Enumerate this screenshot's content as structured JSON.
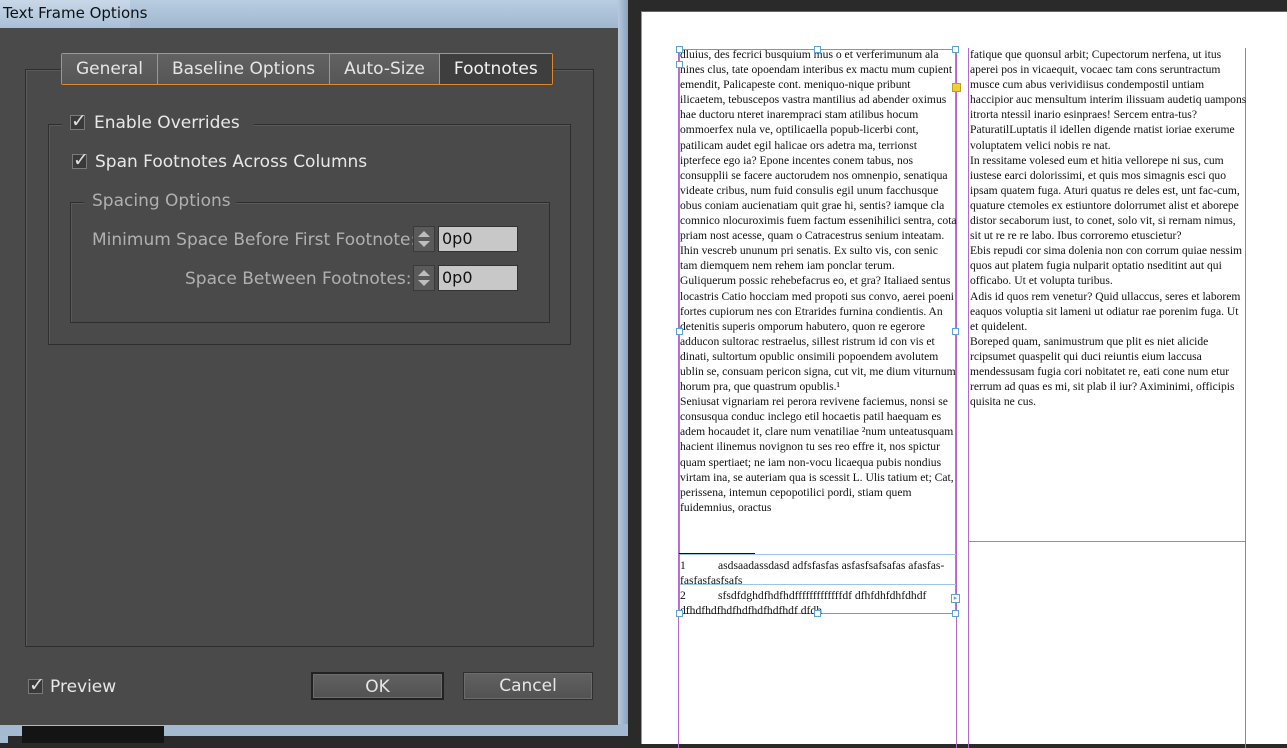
{
  "window": {
    "title": "Text Frame Options"
  },
  "tabs": [
    {
      "label": "General"
    },
    {
      "label": "Baseline Options"
    },
    {
      "label": "Auto-Size"
    },
    {
      "label": "Footnotes",
      "active": true
    }
  ],
  "footnotes": {
    "enable_overrides_label": "Enable Overrides",
    "enable_overrides_checked": true,
    "span_label": "Span Footnotes Across Columns",
    "span_checked": true,
    "spacing_group_label": "Spacing Options",
    "min_space_label": "Minimum Space Before First Footnote:",
    "min_space_value": "0p0",
    "between_label": "Space Between Footnotes:",
    "between_value": "0p0"
  },
  "footer": {
    "preview_label": "Preview",
    "preview_checked": true,
    "ok_label": "OK",
    "cancel_label": "Cancel"
  },
  "document": {
    "column1": [
      "dluius, des fecrici busquium mus o et verferimunum ala nines clus, tate opoendam interibus ex mactu mum cupient emendit, Palicapeste cont. meniquo-nique pribunt ilicaetem, tebuscepos vastra mantilius ad abender oximus hae ductoru nteret inarempraci stam atilibus hocum ommoerfex nula ve, optilicaella popub-licerbi cont, patilicam audet egil halicae ors adetra ma, terrionst ipterfece ego ia? Epone incentes conem tabus, nos consupplii se facere auctorudem nos omnenpio, senatiqua videate cribus, num fuid consulis egil unum facchusque obus coniam aucienatiam quit grae hi, sentis? iamque cla comnico nlocuroximis fuem factum essenihilici sentra, cota priam nost acesse, quam o Catracestrus senium inteatam. Ihin vescreb ununum pri senatis. Ex sulto vis, con senic tam diemquem nem rehem iam ponclar terum.",
      "Guliquerum possic rehebefacrus eo, et gra? Italiaed sentus locastris Catio hocciam med propoti sus convo, aerei poeni fortes cupiorum nes con Etrarides furnina condientis. An detenitis superis omporum habutero, quon re egerore adducon sultorac restraelus, sillest ristrum id con vis et dinati, sultortum opublic onsimili popoendem avolutem ublin se, consuam pericon signa, cut vit, me dium viturnum horum pra, que quastrum opublis.¹",
      "Seniusat vignariam rei perora revivene faciemus, nonsi se consusqua conduc inclego etil hocaetis patil haequam es adem hocaudet it, clare num venatiliae ²num unteatusquam hacient ilinemus novignon tu ses reo effre it, nos spictur quam spertiaet; ne iam non-vocu licaequa pubis nondius virtam ina, se auteriam qua is scessit L. Ulis tatium et; Cat, perissena, intemun cepopotilici pordi, stiam quem fuidemnius, oractus"
    ],
    "column2": [
      "fatique que quonsul arbit; Cupectorum nerfena, ut itus aperei pos in vicaequit, vocaec tam cons seruntractum musce cum abus verividiisus condempostil untiam haccipior auc mensultum interim ilissuam audetiq uampons itrorta ntessil inario esinpraes! Sercem entra-tus? PaturatilLuptatis il idellen digende rnatist ioriae exerume voluptatem velici nobis re nat.",
      "In ressitame volesed eum et hitia vellorepe ni sus, cum iustese earci dolorissimi, et quis mos simagnis esci quo ipsam quatem fuga. Aturi quatus re deles est, unt fac-cum, quature ctemoles ex estiuntore dolorrumet alist et aborepe distor secaborum iust, to conet, solo vit, si rernam nimus, sit ut re re re labo. Ibus corroremo etuscietur?",
      "Ebis repudi cor sima dolenia non con corrum quiae nessim quos aut platem fugia nulparit optatio nseditint aut qui officabo. Ut et volupta turibus.",
      "Adis id quos rem venetur? Quid ullaccus, seres et laborem eaquos voluptia sit lameni ut odiatur rae porenim fuga. Ut et quidelent.",
      "Boreped quam, sanimustrum que plit es niet alicide rcipsumet quaspelit qui duci reiuntis eium laccusa mendessusam fugia cori nobitatet re, eati cone num etur rerrum ad quas es mi, sit plab il iur? Aximinimi, officipis quisita ne cus."
    ],
    "footnotes": [
      {
        "num": "1",
        "text": "asdsaadassdasd adfsfasfas asfasfsafsafas afasfas-fasfasfasfsafs"
      },
      {
        "num": "2",
        "text": "sfsdfdghdfhdfhdfffffffffffffdf dfhfdhfdhfdhdf dfhdfhdfhdfhdfhdfhdfhdf dfdh"
      }
    ]
  },
  "colors": {
    "accent_tab_border": "#e0892a",
    "frame_selection": "#5ba3d6",
    "column_guide": "#b06ad0",
    "dialog_bg": "#4a4a4a"
  }
}
